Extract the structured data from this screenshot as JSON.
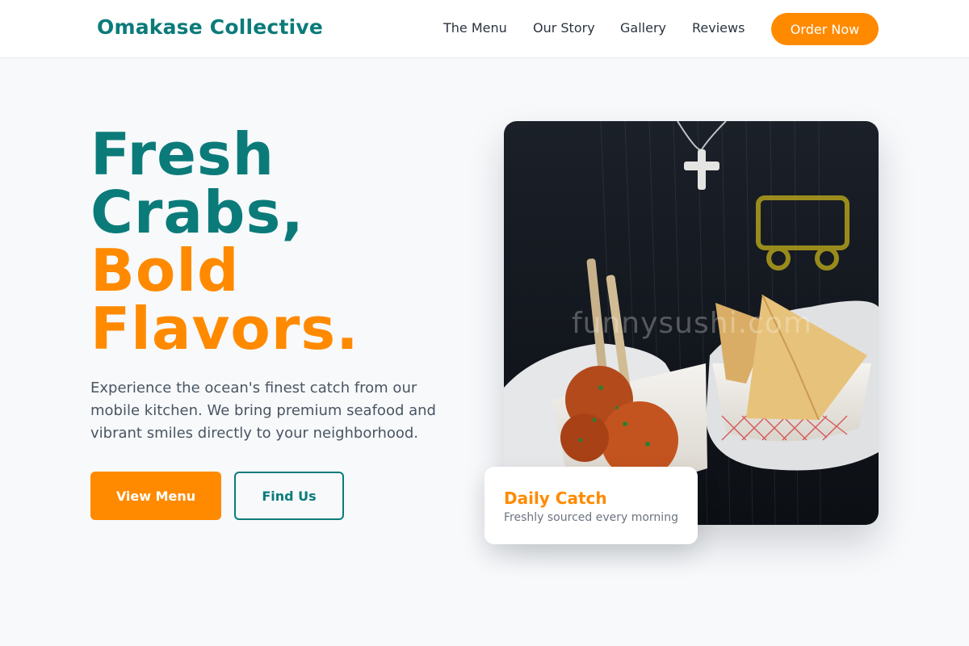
{
  "header": {
    "brand": "Omakase Collective",
    "nav": [
      "The Menu",
      "Our Story",
      "Gallery",
      "Reviews"
    ],
    "cta": "Order Now"
  },
  "hero": {
    "title_line1": "Fresh",
    "title_line2": "Crabs,",
    "title_line3": "Bold",
    "title_line4": "Flavors.",
    "description": "Experience the ocean's finest catch from our mobile kitchen. We bring premium seafood and vibrant smiles directly to your neighborhood.",
    "primary_button": "View Menu",
    "secondary_button": "Find Us"
  },
  "image": {
    "watermark": "funnysushi.com"
  },
  "card": {
    "title": "Daily Catch",
    "subtitle": "Freshly sourced every morning"
  },
  "colors": {
    "teal": "#0b7b7a",
    "orange": "#ff8a00",
    "background": "#f7f9fb"
  }
}
